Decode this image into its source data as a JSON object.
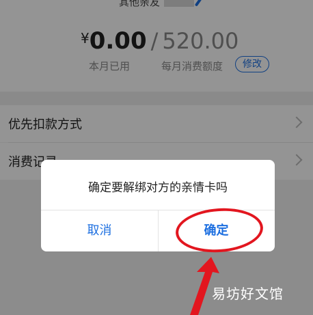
{
  "header": {
    "partial_title": "其他亲友"
  },
  "summary": {
    "currency": "¥",
    "used_amount": "0.00",
    "separator": "/",
    "limit_amount": "520.00",
    "used_label": "本月已用",
    "limit_label": "每月消费额度",
    "modify_label": "修改"
  },
  "menu": {
    "items": [
      {
        "label": "优先扣款方式"
      },
      {
        "label": "消费记录"
      }
    ]
  },
  "dialog": {
    "message": "确定要解绑对方的亲情卡吗",
    "cancel_label": "取消",
    "confirm_label": "确定"
  },
  "annotation": {
    "color": "#e2161f"
  },
  "watermark": {
    "text": "易坊好文馆"
  },
  "colors": {
    "accent": "#1d6fe0"
  }
}
